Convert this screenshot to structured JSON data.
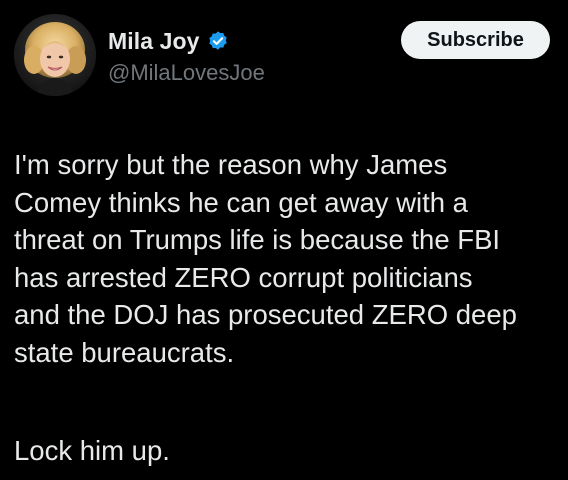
{
  "author": {
    "display_name": "Mila Joy",
    "handle": "@MilaLovesJoe",
    "verified": true,
    "verified_icon": "verified-badge-icon",
    "verified_color": "#1d9bf0"
  },
  "actions": {
    "subscribe_label": "Subscribe"
  },
  "tweet": {
    "lines": [
      "I'm sorry but the reason why James",
      "Comey thinks he can get away with a",
      "threat on Trumps life is because the FBI",
      "has arrested ZERO corrupt politicians",
      "and the DOJ has prosecuted ZERO deep",
      "state bureaucrats."
    ],
    "closing": "Lock him up."
  },
  "colors": {
    "background": "#000000",
    "text_primary": "#e7e9ea",
    "text_secondary": "#71767b",
    "button_bg": "#eff3f4",
    "button_text": "#0f1419"
  }
}
